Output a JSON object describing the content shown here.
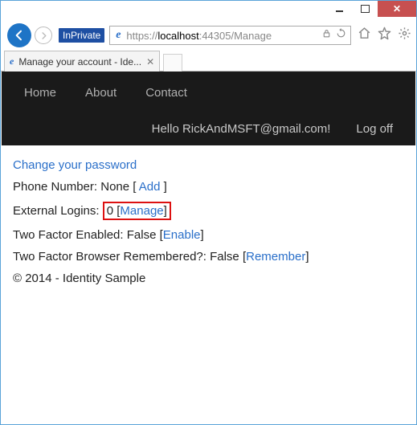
{
  "window": {
    "inprivate_label": "InPrivate",
    "url_scheme": "https://",
    "url_host": "localhost",
    "url_port_path": ":44305/Manage",
    "tab_title": "Manage your account - Ide..."
  },
  "nav": {
    "home": "Home",
    "about": "About",
    "contact": "Contact",
    "greeting": "Hello RickAndMSFT@gmail.com!",
    "logoff": "Log off"
  },
  "page": {
    "change_password": "Change your password",
    "phone_label": "Phone Number: ",
    "phone_value": "None",
    "phone_open": " [ ",
    "phone_add": "Add",
    "phone_close": " ]",
    "ext_label": "External Logins: ",
    "ext_count": "0",
    "ext_manage_open": " [",
    "ext_manage": "Manage",
    "ext_manage_close": "]",
    "tfe_label": "Two Factor Enabled: ",
    "tfe_value": "False",
    "tfe_open": " [",
    "tfe_enable": "Enable",
    "tfe_close": "]",
    "tfbr_label": "Two Factor Browser Remembered?: ",
    "tfbr_value": "False",
    "tfbr_open": " [",
    "tfbr_remember": "Remember",
    "tfbr_close": "]",
    "footer": "© 2014 - Identity Sample"
  }
}
